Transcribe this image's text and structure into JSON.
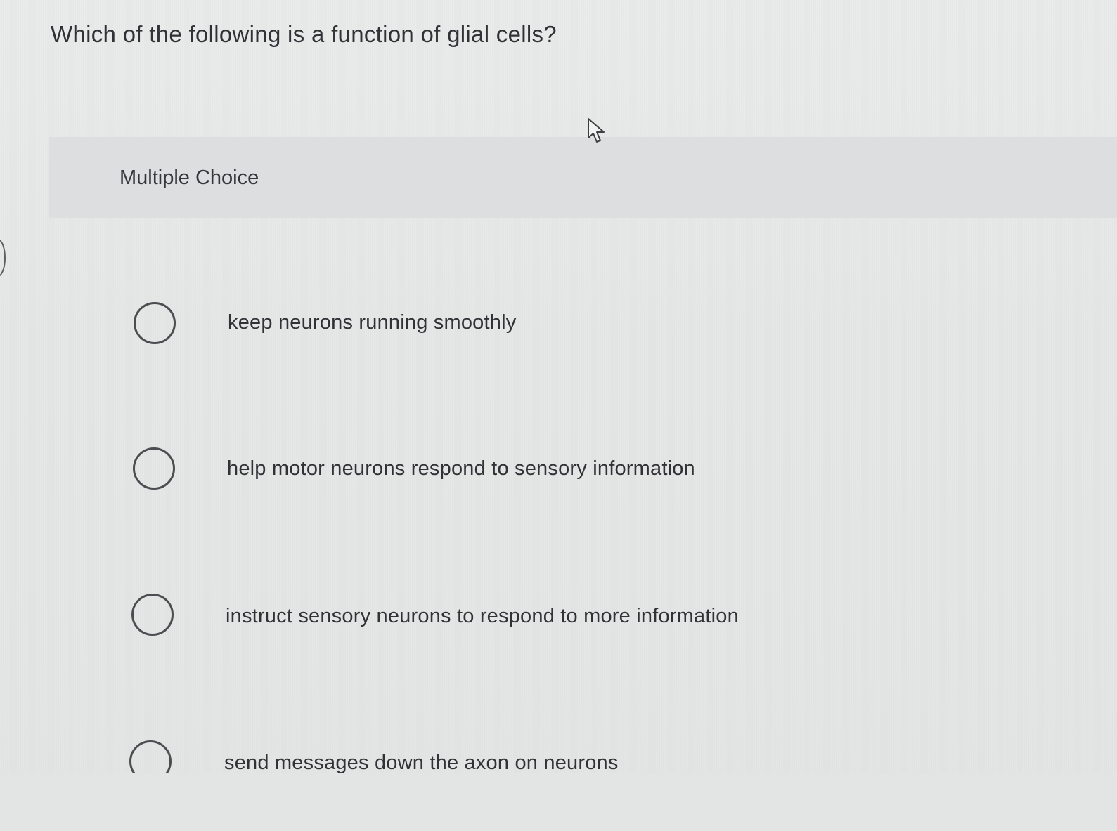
{
  "question": {
    "text": "Which of the following is a function of glial cells?"
  },
  "section": {
    "label": "Multiple Choice"
  },
  "options": [
    {
      "label": "keep neurons running smoothly",
      "selected": false
    },
    {
      "label": "help motor neurons respond to sensory information",
      "selected": false
    },
    {
      "label": "instruct sensory neurons to respond to more information",
      "selected": false
    },
    {
      "label": "send messages down the axon on neurons",
      "selected": false
    }
  ],
  "icons": {
    "cursor": "mouse-pointer-icon",
    "radio": "radio-button-icon"
  },
  "colors": {
    "background": "#e4e6e6",
    "text": "#2f3336",
    "radio_border": "#4a4e51"
  }
}
